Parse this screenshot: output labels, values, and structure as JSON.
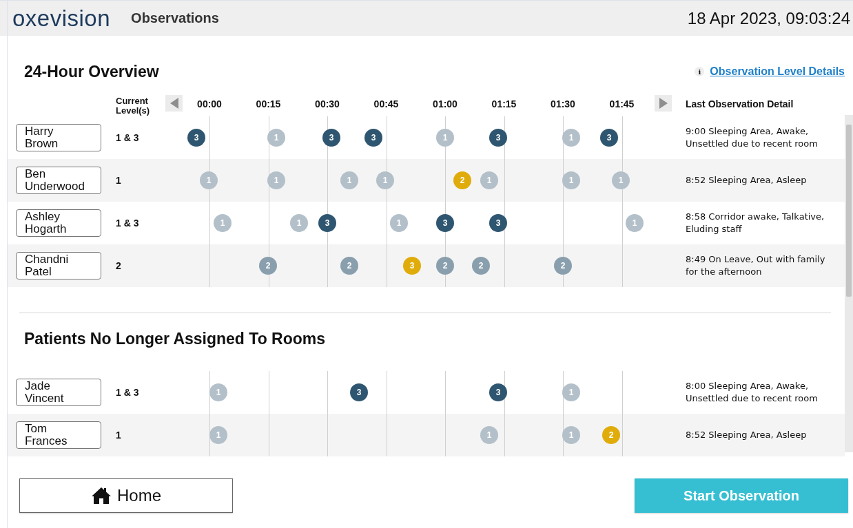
{
  "header": {
    "logo": "oxevision",
    "title": "Observations",
    "datetime": "18 Apr 2023, 09:03:24"
  },
  "overview": {
    "title": "24-Hour Overview",
    "info_icon": "i",
    "link": "Observation Level Details",
    "columns": {
      "current_level": "Current Level(s)",
      "times": [
        "00:00",
        "00:15",
        "00:30",
        "00:45",
        "01:00",
        "01:15",
        "01:30",
        "01:45"
      ],
      "last_detail": "Last Observation Detail"
    },
    "patients": [
      {
        "name": "Harry Brown",
        "current_level": "1 & 3",
        "detail": "9:00 Sleeping Area, Awake, Unsettled due to recent room",
        "observations": [
          {
            "label": "3",
            "color": "#2f5670"
          },
          {
            "label": "1",
            "color": "#b3c0c9"
          },
          {
            "label": "3",
            "color": "#2f5670"
          },
          {
            "label": "3",
            "color": "#2f5670"
          },
          {
            "label": "1",
            "color": "#b3c0c9"
          },
          {
            "label": "3",
            "color": "#2f5670"
          },
          {
            "label": "1",
            "color": "#b3c0c9"
          },
          {
            "label": "3",
            "color": "#2f5670"
          }
        ]
      },
      {
        "name": "Ben Underwood",
        "current_level": "1",
        "detail": "8:52 Sleeping Area, Asleep",
        "observations": [
          {
            "label": "1",
            "color": "#b3c0c9"
          },
          {
            "label": "1",
            "color": "#b3c0c9"
          },
          {
            "label": "1",
            "color": "#b3c0c9"
          },
          {
            "label": "1",
            "color": "#b3c0c9"
          },
          {
            "label": "2",
            "color": "#e0ac0c"
          },
          {
            "label": "1",
            "color": "#b3c0c9"
          },
          {
            "label": "1",
            "color": "#b3c0c9"
          },
          {
            "label": "1",
            "color": "#b3c0c9"
          }
        ]
      },
      {
        "name": "Ashley Hogarth",
        "current_level": "1 & 3",
        "detail": "8:58 Corridor awake, Talkative, Eluding staff",
        "observations": [
          {
            "label": "1",
            "color": "#b3c0c9"
          },
          {
            "label": "1",
            "color": "#b3c0c9"
          },
          {
            "label": "3",
            "color": "#2f5670"
          },
          {
            "label": "1",
            "color": "#b3c0c9"
          },
          {
            "label": "3",
            "color": "#2f5670"
          },
          {
            "label": "3",
            "color": "#2f5670"
          },
          {
            "label": "1",
            "color": "#b3c0c9"
          }
        ]
      },
      {
        "name": "Chandni Patel",
        "current_level": "2",
        "detail": "8:49 On Leave, Out with family for the afternoon",
        "observations": [
          {
            "label": "2",
            "color": "#8a9fad"
          },
          {
            "label": "2",
            "color": "#8a9fad"
          },
          {
            "label": "3",
            "color": "#e0ac0c"
          },
          {
            "label": "2",
            "color": "#8a9fad"
          },
          {
            "label": "2",
            "color": "#8a9fad"
          },
          {
            "label": "2",
            "color": "#8a9fad"
          }
        ]
      }
    ]
  },
  "unassigned": {
    "title": "Patients No Longer Assigned To Rooms",
    "patients": [
      {
        "name": "Jade Vincent",
        "current_level": "1 & 3",
        "detail": "8:00 Sleeping Area, Awake, Unsettled due to recent room",
        "observations": [
          {
            "label": "1",
            "color": "#b3c0c9"
          },
          {
            "label": "3",
            "color": "#2f5670"
          },
          {
            "label": "3",
            "color": "#2f5670"
          },
          {
            "label": "1",
            "color": "#b3c0c9"
          }
        ]
      },
      {
        "name": "Tom Frances",
        "current_level": "1",
        "detail": "8:52 Sleeping Area, Asleep",
        "observations": [
          {
            "label": "1",
            "color": "#b3c0c9"
          },
          {
            "label": "1",
            "color": "#b3c0c9"
          },
          {
            "label": "1",
            "color": "#b3c0c9"
          },
          {
            "label": "2",
            "color": "#e0ac0c"
          }
        ]
      }
    ]
  },
  "buttons": {
    "home": "Home",
    "start": "Start Observation"
  }
}
